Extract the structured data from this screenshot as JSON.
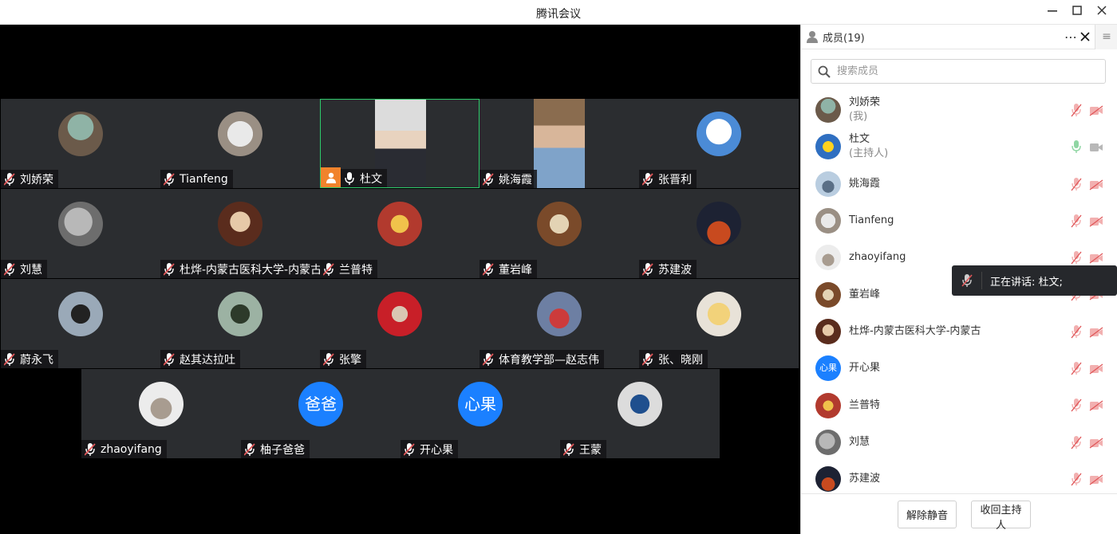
{
  "window": {
    "title": "腾讯会议"
  },
  "colors": {
    "accent": "#1b80ff",
    "host_badge": "#f1832c",
    "active_border": "#2ecb6b",
    "muted_red": "#e0585a"
  },
  "tiles": [
    {
      "name": "刘娇荣",
      "type": "photo",
      "mic": "muted"
    },
    {
      "name": "Tianfeng",
      "type": "photo",
      "mic": "muted"
    },
    {
      "name": "杜文",
      "type": "video",
      "mic": "on",
      "host": true,
      "active": true
    },
    {
      "name": "姚海霞",
      "type": "video",
      "mic": "muted"
    },
    {
      "name": "张晋利",
      "type": "photo",
      "mic": "muted"
    },
    {
      "name": "刘慧",
      "type": "photo",
      "mic": "muted"
    },
    {
      "name": "杜烨-内蒙古医科大学-内蒙古",
      "type": "photo",
      "mic": "muted"
    },
    {
      "name": "兰普特",
      "type": "photo",
      "mic": "muted"
    },
    {
      "name": "董岩峰",
      "type": "photo",
      "mic": "muted"
    },
    {
      "name": "苏建波",
      "type": "photo",
      "mic": "muted"
    },
    {
      "name": "蔚永飞",
      "type": "photo",
      "mic": "muted"
    },
    {
      "name": "赵其达拉吐",
      "type": "photo",
      "mic": "muted"
    },
    {
      "name": "张擎",
      "type": "photo",
      "mic": "muted"
    },
    {
      "name": "体育教学部—赵志伟",
      "type": "photo",
      "mic": "muted"
    },
    {
      "name": "张、晓刚",
      "type": "photo",
      "mic": "muted"
    },
    {
      "name": "zhaoyifang",
      "type": "photo",
      "mic": "muted"
    },
    {
      "name": "柚子爸爸",
      "type": "text",
      "avatar_text": "爸爸",
      "mic": "muted"
    },
    {
      "name": "开心果",
      "type": "text",
      "avatar_text": "心果",
      "mic": "muted"
    },
    {
      "name": "王蒙",
      "type": "photo",
      "mic": "muted"
    }
  ],
  "panel": {
    "title": "成员(19)",
    "search_placeholder": "搜索成员",
    "members": [
      {
        "name": "刘娇荣",
        "sub": "(我)",
        "mic": "muted"
      },
      {
        "name": "杜文",
        "sub": "(主持人)",
        "mic": "on"
      },
      {
        "name": "姚海霞",
        "sub": "",
        "mic": "muted"
      },
      {
        "name": "Tianfeng",
        "sub": "",
        "mic": "muted"
      },
      {
        "name": "zhaoyifang",
        "sub": "",
        "mic": "muted"
      },
      {
        "name": "董岩峰",
        "sub": "",
        "mic": "muted"
      },
      {
        "name": "杜烨-内蒙古医科大学-内蒙古",
        "sub": "",
        "mic": "muted"
      },
      {
        "name": "开心果",
        "sub": "",
        "mic": "muted",
        "avatar_text": "心果"
      },
      {
        "name": "兰普特",
        "sub": "",
        "mic": "muted"
      },
      {
        "name": "刘慧",
        "sub": "",
        "mic": "muted"
      },
      {
        "name": "苏建波",
        "sub": "",
        "mic": "muted"
      }
    ],
    "unmute_all": "解除静音",
    "reclaim_host": "收回主持人"
  },
  "toast": {
    "text": "正在讲话: 杜文;"
  }
}
